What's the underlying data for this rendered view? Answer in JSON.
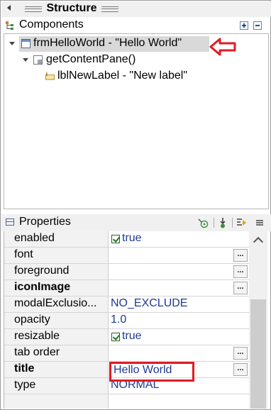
{
  "view": {
    "title": "Structure",
    "components_title": "Components",
    "properties_title": "Properties"
  },
  "tree": {
    "items": [
      {
        "label": "frmHelloWorld - \"Hello World\"",
        "expanded": true,
        "selected": true
      },
      {
        "label": "getContentPane()",
        "expanded": true
      },
      {
        "label": "lblNewLabel - \"New label\""
      }
    ]
  },
  "properties": {
    "rows": [
      {
        "name": "enabled",
        "value": "true",
        "checkbox": true
      },
      {
        "name": "font",
        "value": "",
        "dots": true
      },
      {
        "name": "foreground",
        "value": "",
        "dots": true
      },
      {
        "name": "iconImage",
        "value": "",
        "dots": true,
        "bold": true
      },
      {
        "name": "modalExclusio...",
        "value": "NO_EXCLUDE"
      },
      {
        "name": "opacity",
        "value": "1.0"
      },
      {
        "name": "resizable",
        "value": "true",
        "checkbox": true
      },
      {
        "name": "tab order",
        "value": "",
        "dots": true
      },
      {
        "name": "title",
        "value": "Hello World",
        "dots": true,
        "bold": true,
        "highlighted": true
      },
      {
        "name": "type",
        "value": "NORMAL"
      }
    ],
    "dots_label": "..."
  },
  "icons": {
    "collapse": "collapse-view-icon",
    "components": "components-tree-icon",
    "frame": "jframe-icon",
    "panel": "content-pane-icon",
    "label": "jlabel-icon",
    "properties": "properties-icon",
    "expand_all": "expand-all-icon",
    "collapse_all": "collapse-all-icon",
    "show_events": "show-events-icon",
    "goto_definition": "goto-definition-icon",
    "advanced": "show-advanced-icon"
  },
  "colors": {
    "highlight": "#e01b24",
    "value_text": "#1f3a93",
    "selection": "#d9d9d9"
  }
}
